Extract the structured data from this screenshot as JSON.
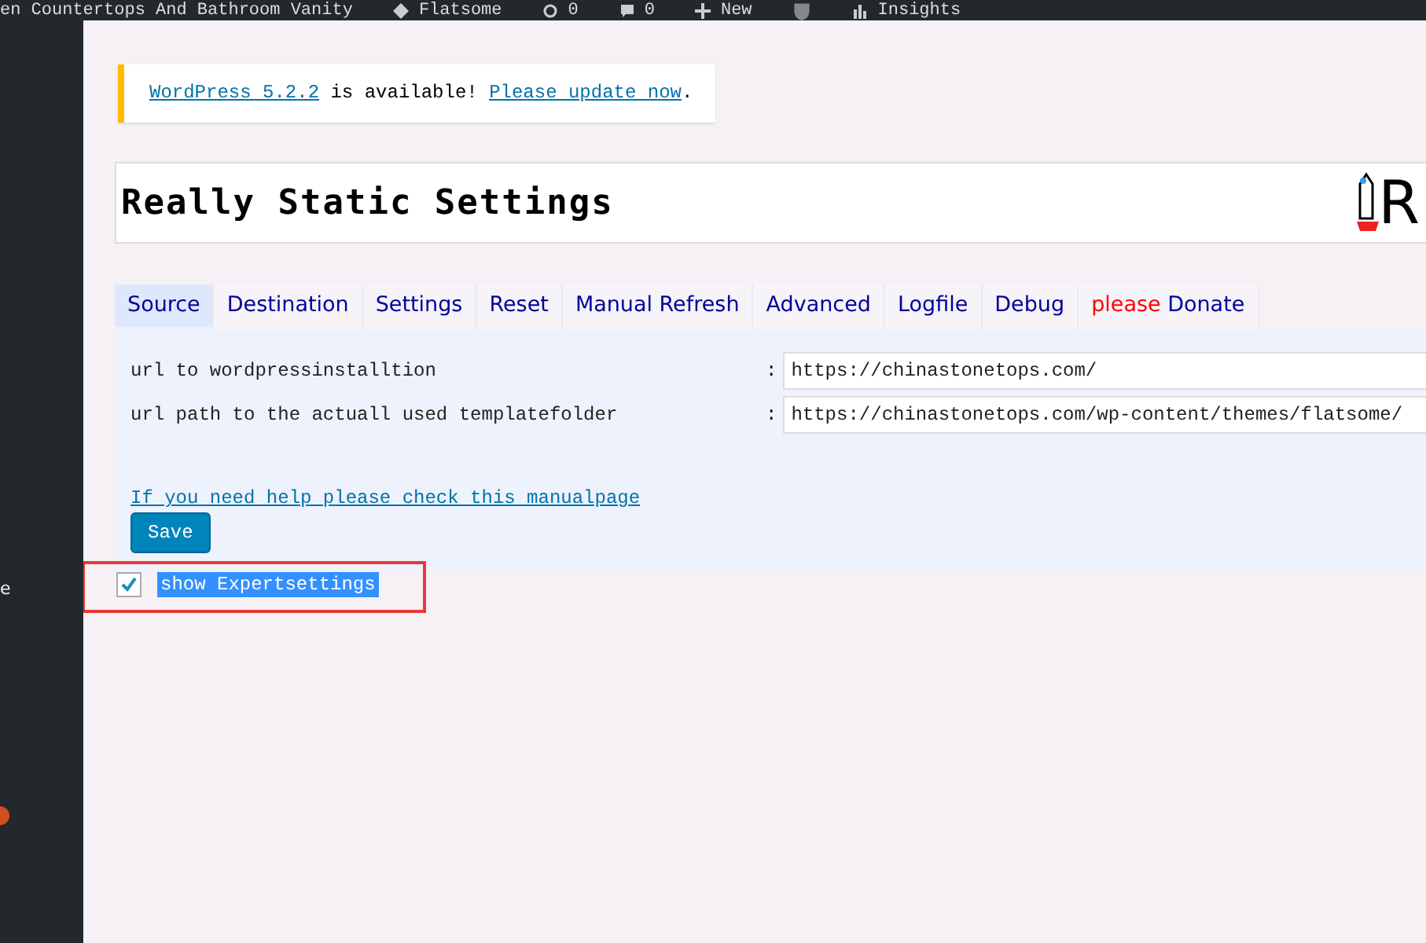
{
  "admin_bar": {
    "site_title": "en Countertops And Bathroom Vanity",
    "theme": "Flatsome",
    "updates": "0",
    "comments": "0",
    "new": "New",
    "insights": "Insights"
  },
  "sidebar": {
    "items": [
      {
        "label": "e"
      }
    ],
    "badge_dot": true
  },
  "notice": {
    "link1": "WordPress 5.2.2",
    "text": " is available! ",
    "link2": "Please update now",
    "end": "."
  },
  "header": {
    "title": "Really Static Settings",
    "logo_text": "R"
  },
  "tabs": [
    {
      "label": "Source",
      "selected": true
    },
    {
      "label": "Destination",
      "selected": false
    },
    {
      "label": "Settings",
      "selected": false
    },
    {
      "label": "Reset",
      "selected": false
    },
    {
      "label": "Manual Refresh",
      "selected": false
    },
    {
      "label": "Advanced",
      "selected": false
    },
    {
      "label": "Logfile",
      "selected": false
    },
    {
      "label": "Debug",
      "selected": false
    },
    {
      "label": "Donate",
      "prefix": "please",
      "selected": false
    }
  ],
  "fields": [
    {
      "label": "url to wordpressinstalltion",
      "value": "https://chinastonetops.com/"
    },
    {
      "label": "url path to the actuall used templatefolder",
      "value": "https://chinastonetops.com/wp-content/themes/flatsome/"
    }
  ],
  "separator": ":",
  "help_link": "If you need help please check this manualpage",
  "save_button": "Save",
  "expert": {
    "label": "show Expertsettings",
    "checked": true,
    "highlighted": true
  }
}
